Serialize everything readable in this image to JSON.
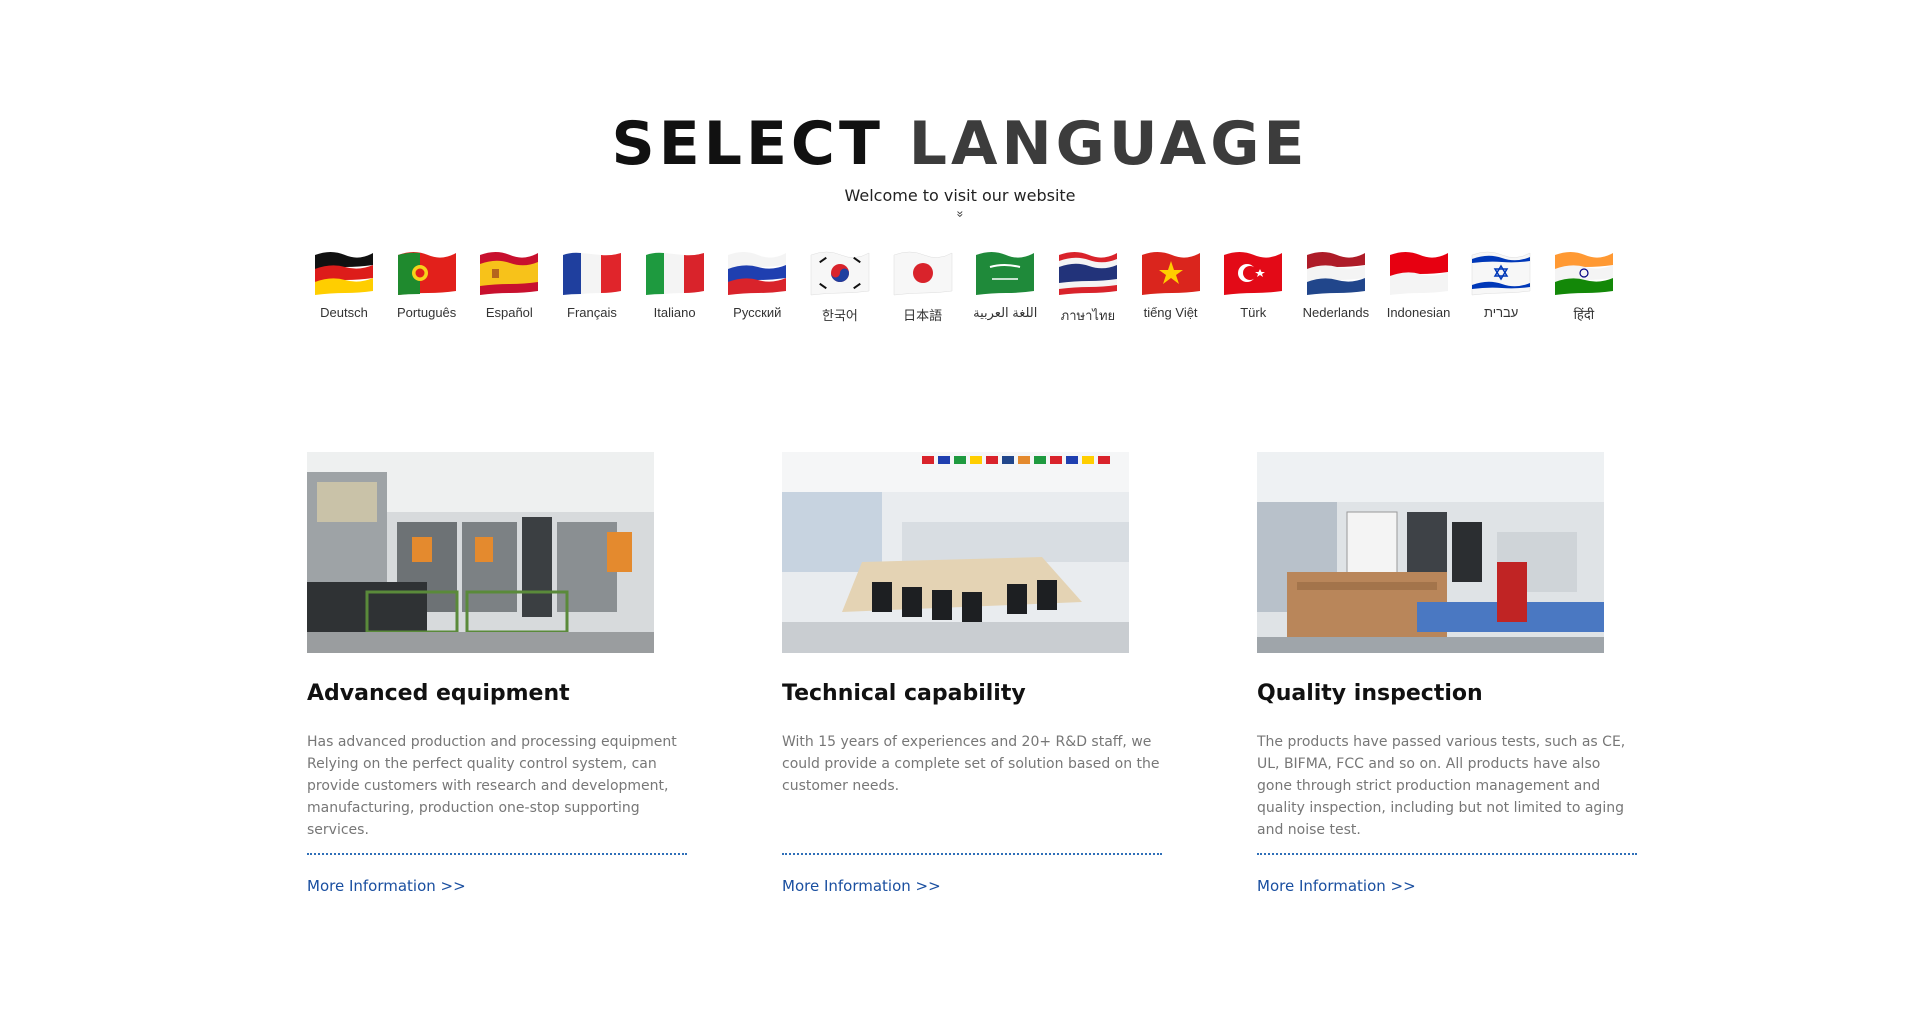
{
  "header": {
    "title_word1": "SELECT",
    "title_word2": "LANGUAGE",
    "subtitle": "Welcome to visit our website",
    "chevron": "»"
  },
  "languages": [
    {
      "label": "Deutsch",
      "flag": "germany-flag"
    },
    {
      "label": "Português",
      "flag": "portugal-flag"
    },
    {
      "label": "Español",
      "flag": "spain-flag"
    },
    {
      "label": "Français",
      "flag": "france-flag"
    },
    {
      "label": "Italiano",
      "flag": "italy-flag"
    },
    {
      "label": "Русский",
      "flag": "russia-flag"
    },
    {
      "label": "한국어",
      "flag": "korea-flag"
    },
    {
      "label": "日本語",
      "flag": "japan-flag"
    },
    {
      "label": "اللغة العربية",
      "flag": "saudi-arabia-flag"
    },
    {
      "label": "ภาษาไทย",
      "flag": "thailand-flag"
    },
    {
      "label": "tiếng Việt",
      "flag": "vietnam-flag"
    },
    {
      "label": "Türk",
      "flag": "turkey-flag"
    },
    {
      "label": "Nederlands",
      "flag": "netherlands-flag"
    },
    {
      "label": "Indonesian",
      "flag": "indonesia-flag"
    },
    {
      "label": "עברית",
      "flag": "israel-flag"
    },
    {
      "label": "हिंदी",
      "flag": "india-flag"
    }
  ],
  "features": [
    {
      "title": "Advanced equipment",
      "text": "Has advanced production and processing equipment Relying on the perfect quality control system, can provide customers with research and development, manufacturing, production one-stop supporting services.",
      "link": "More Information >>",
      "image": "factory-machines-photo"
    },
    {
      "title": "Technical capability",
      "text": "With 15 years of experiences and 20+ R&D staff, we could provide a complete set of solution based on the customer needs.",
      "link": "More Information >>",
      "image": "office-meeting-room-photo"
    },
    {
      "title": "Quality inspection",
      "text": "The products have passed various tests, such as CE, UL, BIFMA, FCC and so on. All products have also gone through strict production management and quality inspection, including but not limited to aging and noise test.",
      "link": "More Information >>",
      "image": "production-line-photo"
    }
  ],
  "colors": {
    "link": "#1a4fa0",
    "divider": "#2f6fb8",
    "body_text": "#777777"
  }
}
